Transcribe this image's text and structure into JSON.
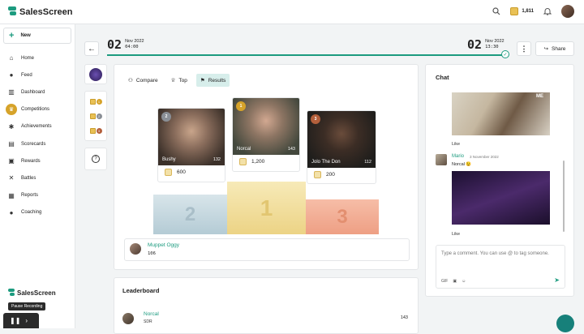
{
  "app": {
    "brand": "SalesScreen",
    "coins": "1,811"
  },
  "sidebar": {
    "new_label": "New",
    "items": [
      {
        "label": "Home",
        "icon": "home-icon"
      },
      {
        "label": "Feed",
        "icon": "chat-bubble-icon"
      },
      {
        "label": "Dashboard",
        "icon": "bar-chart-icon"
      },
      {
        "label": "Competitions",
        "icon": "trophy-icon"
      },
      {
        "label": "Achievements",
        "icon": "medal-icon"
      },
      {
        "label": "Scorecards",
        "icon": "scorecard-icon"
      },
      {
        "label": "Rewards",
        "icon": "gift-icon"
      },
      {
        "label": "Battles",
        "icon": "swords-icon"
      },
      {
        "label": "Reports",
        "icon": "report-icon"
      },
      {
        "label": "Coaching",
        "icon": "lightbulb-icon"
      }
    ],
    "active": "Competitions",
    "brand": "SalesScreen",
    "tooltip": "Pause Recording"
  },
  "header": {
    "start": {
      "day": "02",
      "month": "Nov 2022",
      "time": "04:00"
    },
    "end": {
      "day": "02",
      "month": "Nov 2022",
      "time": "13:30"
    },
    "progress_fraction": 1.0,
    "share_label": "Share"
  },
  "tabs": [
    {
      "label": "Compare",
      "icon": "people-icon"
    },
    {
      "label": "Top",
      "icon": "trophy-icon"
    },
    {
      "label": "Results",
      "icon": "flag-icon"
    }
  ],
  "active_tab": "Results",
  "podium": [
    {
      "place": "2",
      "name": "Bushy",
      "score": "132",
      "points": "600",
      "medal_color": "#8a8f96",
      "step_color": "#b9cfd9",
      "photo": "#6b5647"
    },
    {
      "place": "1",
      "name": "Norcal",
      "score": "143",
      "points": "1,200",
      "medal_color": "#d6a32a",
      "step_color": "#f1dc93",
      "photo": "#5f6a55"
    },
    {
      "place": "3",
      "name": "Jolo The Don",
      "score": "112",
      "points": "200",
      "medal_color": "#b35f3b",
      "step_color": "#f0a78c",
      "photo": "#34302c"
    }
  ],
  "winner_row": {
    "name": "Muppet Oggy",
    "score": "106"
  },
  "leaderboard": {
    "title": "Leaderboard",
    "rows": [
      {
        "name": "Norcal",
        "role": "SDR",
        "score": "143"
      }
    ]
  },
  "chat": {
    "title": "Chat",
    "like_label": "Like",
    "gif1_tag": "ME",
    "message": {
      "author": "Mario",
      "time": "3 November 2022",
      "text": "Norcal 😉"
    },
    "placeholder": "Type a comment. You can use @ to tag someone.",
    "tools": [
      "GIF",
      "image-icon",
      "smile-icon"
    ]
  }
}
